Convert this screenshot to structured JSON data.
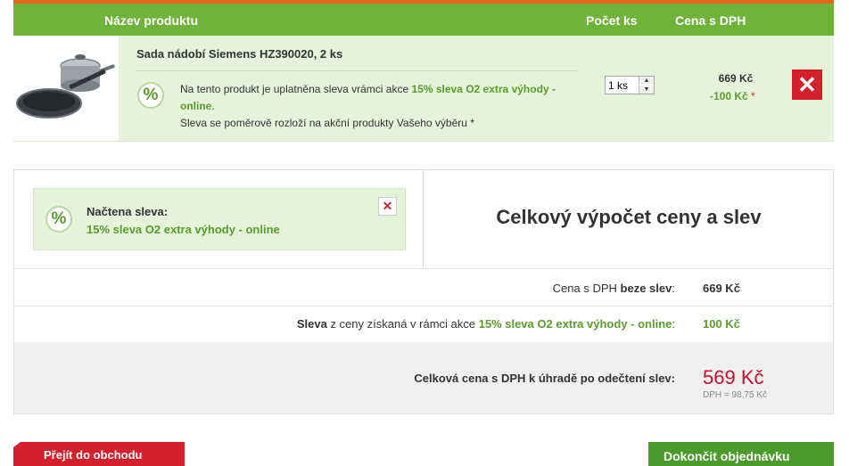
{
  "header": {
    "col_product": "Název produktu",
    "col_qty": "Počet ks",
    "col_price": "Cena s DPH"
  },
  "product": {
    "name": "Sada nádobí Siemens HZ390020, 2 ks",
    "percent_icon": "%",
    "promo_prefix": "Na tento produkt je uplatněna sleva vrámci akce ",
    "promo_name": "15% sleva O2 extra výhody - online",
    "promo_suffix": ".",
    "promo_note": "Sleva se poměrově rozloží na akční produkty Vašeho výběru *",
    "quantity_value": "1 ks",
    "price": "669 Kč",
    "discount": "-100 Kč",
    "discount_mark": "*",
    "remove_icon": "✕"
  },
  "discount_box": {
    "label": "Načtena sleva:",
    "name": "15% sleva O2 extra výhody - online",
    "remove_icon": "✕"
  },
  "summary": {
    "title": "Celkový výpočet ceny a slev",
    "row1": {
      "prefix": "Cena s DPH ",
      "bold": "beze slev",
      "suffix": ":",
      "value": "669 Kč"
    },
    "row2": {
      "bold": "Sleva",
      "middle": " z ceny získaná v rámci akce ",
      "promo": "15% sleva O2 extra výhody - online",
      "suffix": ":",
      "value": "100 Kč"
    },
    "total_label": "Celková cena s DPH k úhradě po odečtení slev:",
    "total_value": "569 Kč",
    "vat_note": "DPH = 98,75 Kč"
  },
  "buttons": {
    "back": "Přejít do obchodu",
    "finish": "Dokončit objednávku"
  },
  "colors": {
    "green": "#6fb33a",
    "accent_orange": "#e6651d",
    "red": "#d4202c",
    "price_red": "#c8102e"
  }
}
